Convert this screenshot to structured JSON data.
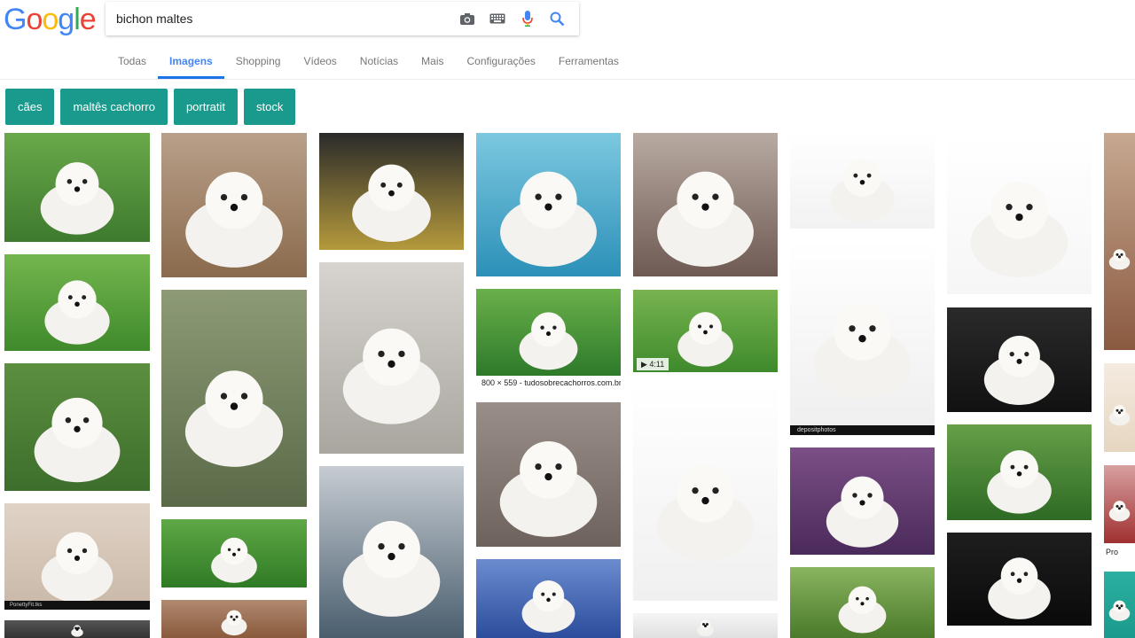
{
  "logo": {
    "letters": [
      "G",
      "o",
      "o",
      "g",
      "l",
      "e"
    ],
    "colors": [
      "#4285f4",
      "#ea4335",
      "#fbbc05",
      "#4285f4",
      "#34a853",
      "#ea4335"
    ]
  },
  "search": {
    "query": "bichon maltes",
    "icons": [
      "camera-icon",
      "keyboard-icon",
      "mic-icon",
      "search-icon"
    ]
  },
  "tabs": [
    "Todas",
    "Imagens",
    "Shopping",
    "Vídeos",
    "Notícias",
    "Mais",
    "Configurações",
    "Ferramentas"
  ],
  "active_tab": "Imagens",
  "chips": [
    "cães",
    "maltês cachorro",
    "portratit",
    "stock"
  ],
  "tiles": {
    "t_c4_2_caption": "800 × 559 - tudosobrecachorros.com.br",
    "t_c5_2_duration": "▶ 4:11",
    "t_c7_partial_caption": "Pro",
    "t_c6_2_watermark": "depositphotos",
    "t_c1_4_watermark": "PonettyFit.tks"
  },
  "colors": {
    "accent": "#1a73e8",
    "chip_bg": "#1a9a8c"
  }
}
